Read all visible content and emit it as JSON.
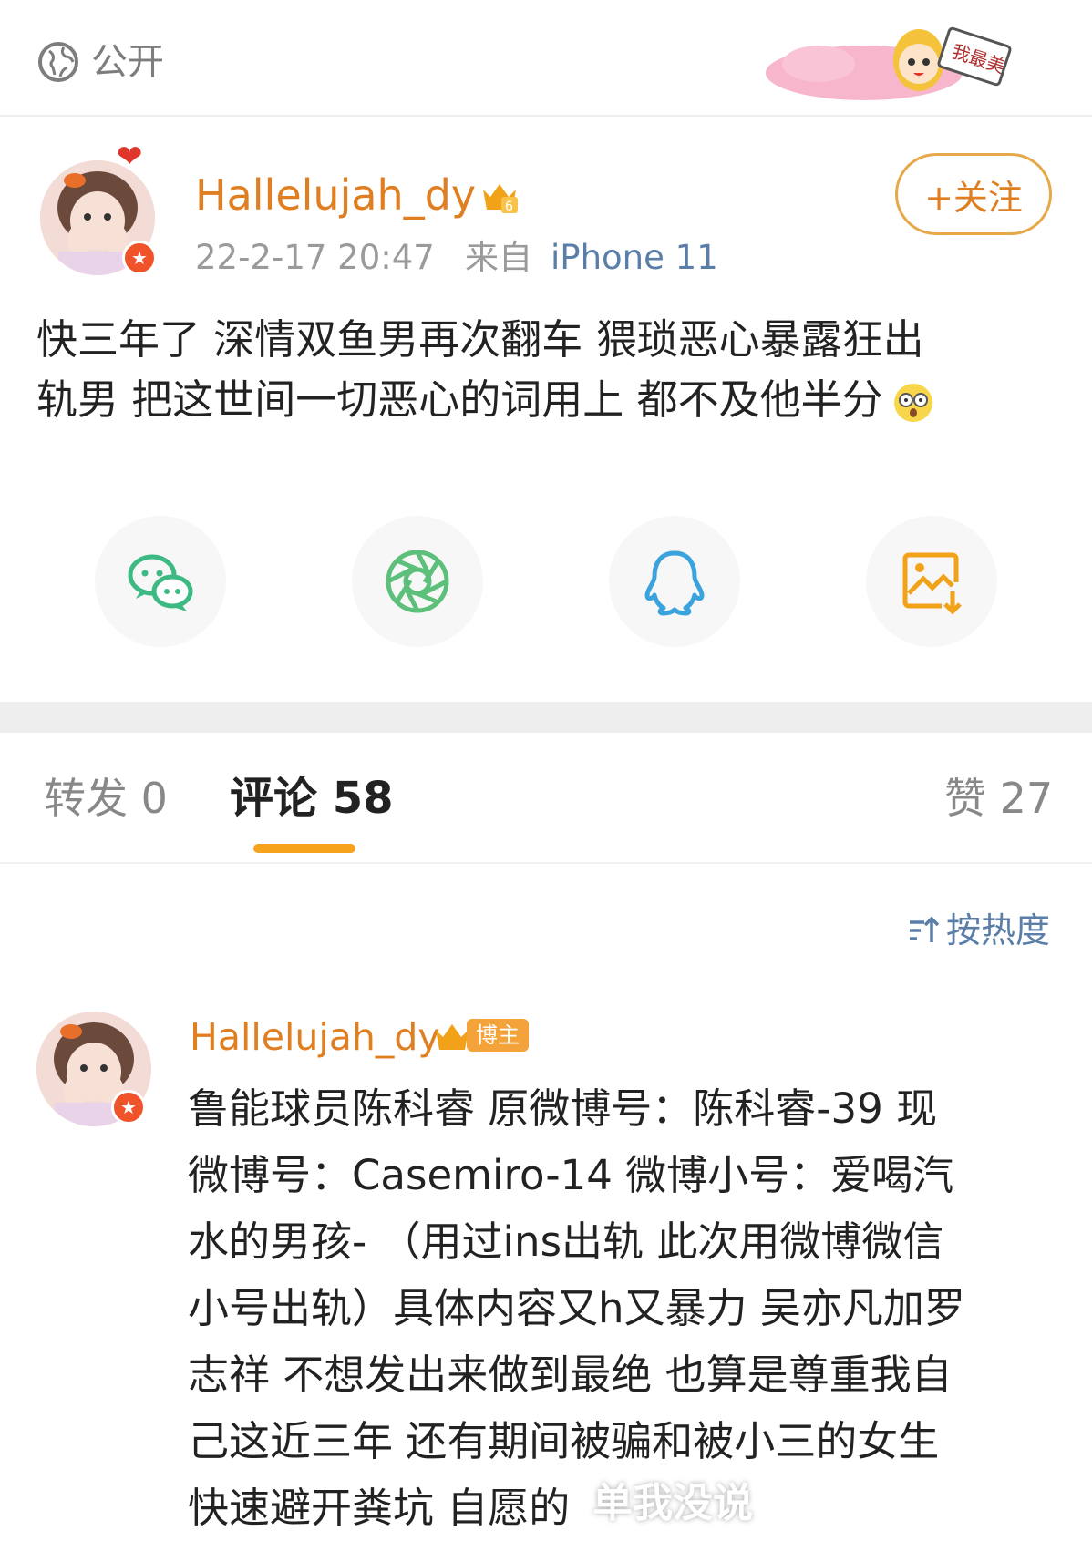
{
  "topbar": {
    "visibility_icon": "globe-icon",
    "visibility_label": "公开",
    "sticker_text": "我最美"
  },
  "post": {
    "author": {
      "name": "Hallelujah_dy",
      "avatar_icon": "avatar",
      "verified_icon": "verified-badge-icon",
      "level_icon": "crown-icon",
      "level": "6"
    },
    "time": "22-2-17 20:47",
    "source_prefix": "来自",
    "source_device": "iPhone 11",
    "follow_label": "+关注",
    "text_line1": "快三年了 深情双鱼男再次翻车 猥琐恶心暴露狂出",
    "text_line2": "轨男  把这世间一切恶心的词用上 都不及他半分",
    "emoji": "shocked-emoji-icon"
  },
  "share": [
    {
      "name": "wechat",
      "icon": "wechat-icon",
      "color": "#3dba84"
    },
    {
      "name": "moments",
      "icon": "moments-icon",
      "color": "#5cc07a"
    },
    {
      "name": "qq",
      "icon": "qq-icon",
      "color": "#3aa3de"
    },
    {
      "name": "save-image",
      "icon": "save-image-icon",
      "color": "#f2a218"
    }
  ],
  "tabs": {
    "repost": "转发 0",
    "comment": "评论 58",
    "like": "赞 27",
    "active": "comment",
    "accent": "#f7a21b"
  },
  "sort": {
    "label": "按热度",
    "icon": "sort-icon"
  },
  "comment": {
    "author": "Hallelujah_dy",
    "badge": "博主",
    "lines": [
      "鲁能球员陈科睿 原微博号：陈科睿-39 现",
      "微博号：Casemiro-14 微博小号：爱喝汽",
      "水的男孩- （用过ins出轨 此次用微博微信",
      "小号出轨）具体内容又h又暴力 吴亦凡加罗",
      "志祥 不想发出来做到最绝 也算是尊重我自",
      "己这近三年 还有期间被骗和被小三的女生",
      "快速避开粪坑 自愿的"
    ]
  },
  "watermark": "单我没说",
  "colors": {
    "username": "#e07e22",
    "link_blue": "#5a7ea8",
    "meta_gray": "#9a9a9a"
  }
}
